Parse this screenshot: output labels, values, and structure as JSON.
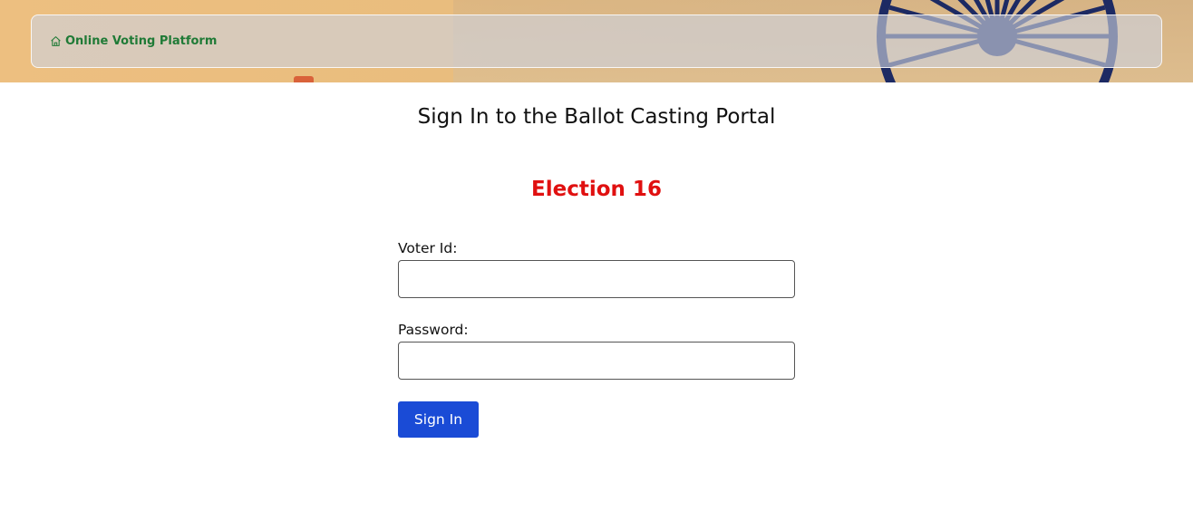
{
  "navbar": {
    "brand_label": "Online Voting Platform",
    "brand_icon": "home-icon",
    "brand_color": "#1f7a36"
  },
  "main": {
    "title": "Sign In to the Ballot Casting Portal",
    "election_name": "Election 16",
    "election_color": "#e01010"
  },
  "form": {
    "voter_id_label": "Voter Id:",
    "voter_id_value": "",
    "password_label": "Password:",
    "password_value": "",
    "submit_label": "Sign In",
    "submit_color": "#1a4bd6"
  }
}
